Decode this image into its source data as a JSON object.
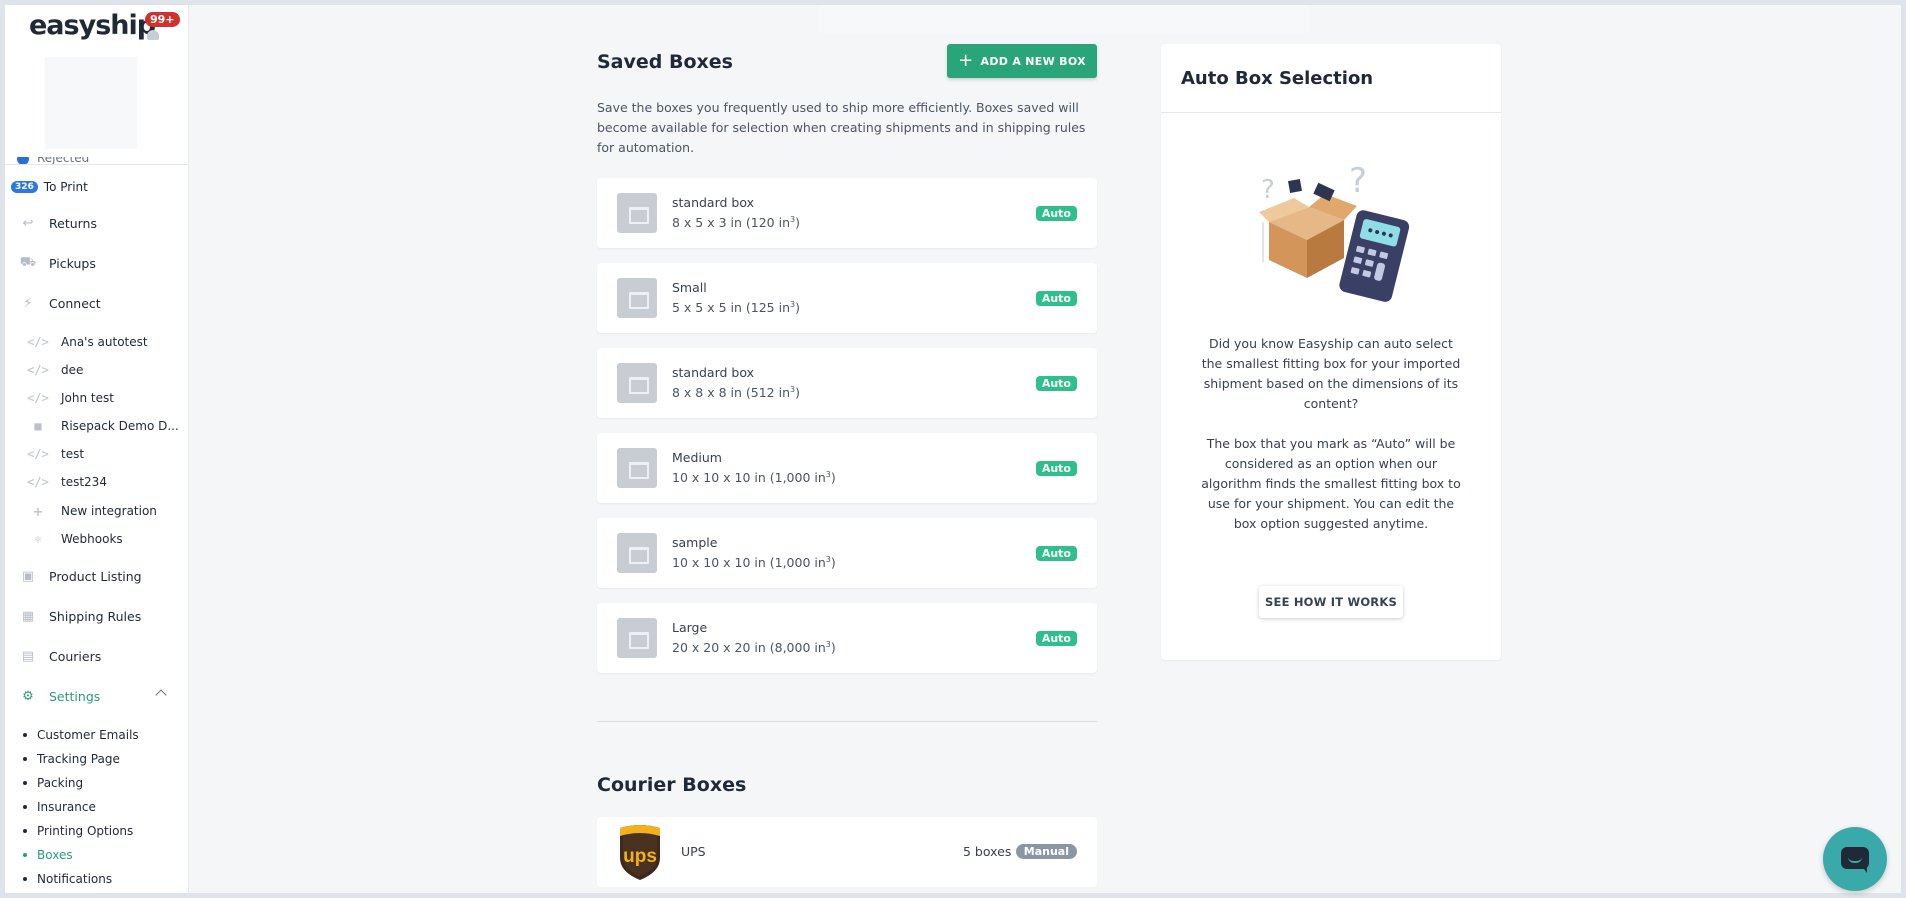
{
  "sidebar": {
    "logo_text": "easyship",
    "notification_badge": "99+",
    "partial_item": "Rejected",
    "to_print": {
      "count": "326",
      "label": "To Print"
    },
    "items": {
      "returns": "Returns",
      "pickups": "Pickups",
      "connect": "Connect",
      "product_listing": "Product Listing",
      "shipping_rules": "Shipping Rules",
      "couriers": "Couriers",
      "settings": "Settings"
    },
    "integrations": [
      "Ana's autotest",
      "dee",
      "John test",
      "Risepack Demo D...",
      "test",
      "test234",
      "New integration",
      "Webhooks"
    ],
    "settings_sub": [
      "Customer Emails",
      "Tracking Page",
      "Packing",
      "Insurance",
      "Printing Options",
      "Boxes",
      "Notifications"
    ]
  },
  "main": {
    "saved_title": "Saved Boxes",
    "add_button": "ADD A NEW BOX",
    "description": "Save the boxes you frequently used to ship more efficiently. Boxes saved will become available for selection when creating shipments and in shipping rules for automation.",
    "boxes": [
      {
        "name": "standard box",
        "dims": "8 x 5 x 3 in (120 in",
        "sup": "3",
        "close": ")",
        "tag": "Auto"
      },
      {
        "name": "Small",
        "dims": "5 x 5 x 5 in (125 in",
        "sup": "3",
        "close": ")",
        "tag": "Auto"
      },
      {
        "name": "standard box",
        "dims": "8 x 8 x 8 in (512 in",
        "sup": "3",
        "close": ")",
        "tag": "Auto"
      },
      {
        "name": "Medium",
        "dims": "10 x 10 x 10 in (1,000 in",
        "sup": "3",
        "close": ")",
        "tag": "Auto"
      },
      {
        "name": "sample",
        "dims": "10 x 10 x 10 in (1,000 in",
        "sup": "3",
        "close": ")",
        "tag": "Auto"
      },
      {
        "name": "Large",
        "dims": "20 x 20 x 20 in (8,000 in",
        "sup": "3",
        "close": ")",
        "tag": "Auto"
      }
    ],
    "courier_title": "Courier Boxes",
    "courier": {
      "name": "UPS",
      "count": "5 boxes",
      "tag": "Manual"
    }
  },
  "panel": {
    "title": "Auto Box Selection",
    "text1": "Did you know Easyship can auto select the smallest fitting box for your imported shipment based on the dimensions of its content?",
    "text2": "The box that you mark as “Auto” will be considered as an option when our algorithm finds the smallest fitting box to use for your shipment. You can edit the box option suggested anytime.",
    "button": "SEE HOW IT WORKS"
  },
  "colors": {
    "accent": "#2aa57a",
    "auto_pill": "#2fbf8b",
    "manual_pill": "#8b96a4",
    "chat": "#39a9a9"
  }
}
